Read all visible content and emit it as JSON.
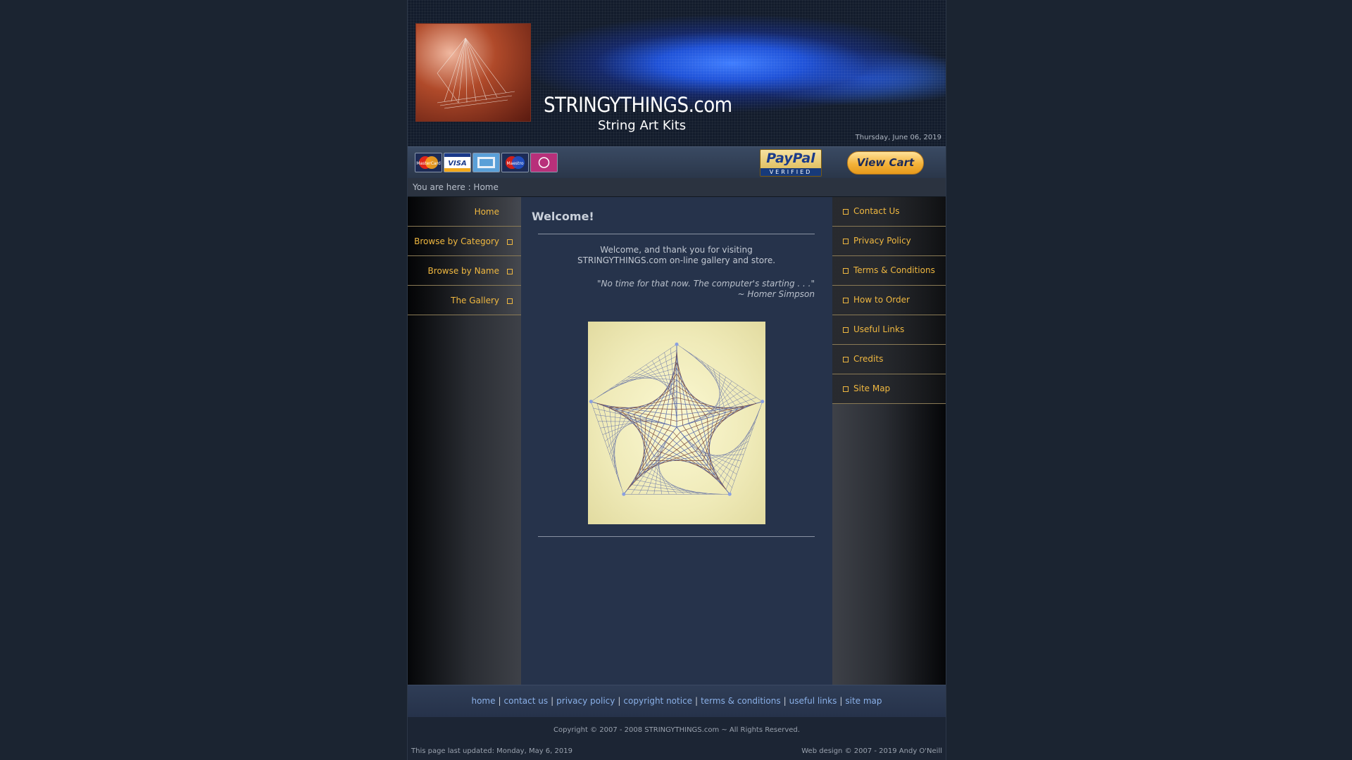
{
  "header": {
    "site_title": "STRINGYTHINGS.com",
    "site_subtitle": "String Art Kits",
    "date": "Thursday, June 06, 2019"
  },
  "payment": {
    "cards": [
      {
        "icon": "mastercard-icon",
        "label": "MasterCard"
      },
      {
        "icon": "visa-icon",
        "label": "VISA"
      },
      {
        "icon": "amex-icon",
        "label": ""
      },
      {
        "icon": "maestro-icon",
        "label": "Maestro"
      },
      {
        "icon": "solo-icon",
        "label": ""
      }
    ],
    "paypal_logo": "PayPal",
    "paypal_verified": "VERIFIED",
    "view_cart_label": "View Cart"
  },
  "breadcrumb": "You are here : Home",
  "left_nav": [
    {
      "label": "Home"
    },
    {
      "label": "Browse by Category"
    },
    {
      "label": "Browse by Name"
    },
    {
      "label": "The Gallery"
    }
  ],
  "right_nav": [
    {
      "label": "Contact Us"
    },
    {
      "label": "Privacy Policy"
    },
    {
      "label": "Terms & Conditions"
    },
    {
      "label": "How to Order"
    },
    {
      "label": "Useful Links"
    },
    {
      "label": "Credits"
    },
    {
      "label": "Site Map"
    }
  ],
  "content": {
    "title": "Welcome!",
    "intro_line1": "Welcome, and thank you for visiting",
    "intro_line2": "STRINGYTHINGS.com on-line gallery and store.",
    "quote_line1": "\"No time for that now. The computer's starting . . .\"",
    "quote_line2": "~ Homer Simpson"
  },
  "footer": {
    "links": [
      "home",
      "contact us",
      "privacy policy",
      "copyright notice",
      "terms & conditions",
      "useful links",
      "site map"
    ],
    "copyright": "Copyright © 2007 - 2008 STRINGYTHINGS.com ~ All Rights Reserved.",
    "last_updated": "This page last updated: Monday, May 6, 2019",
    "web_design": "Web design © 2007 - 2019 Andy O'Neill"
  },
  "colors": {
    "page_bg": "#1b2431",
    "nav_text": "#f0b840",
    "content_bg": "#26334b",
    "footer_link": "#8ab0e8"
  }
}
